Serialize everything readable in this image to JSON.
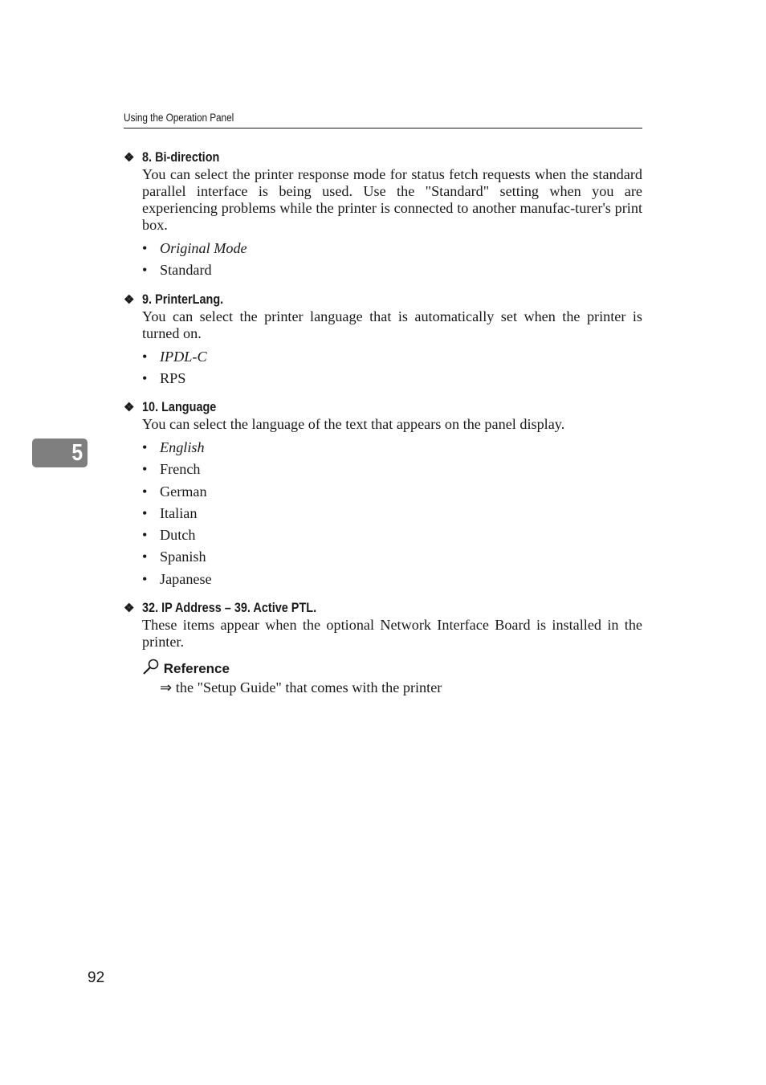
{
  "header": {
    "running_title": "Using the Operation Panel"
  },
  "chapter_tab": "5",
  "page_number": "92",
  "sections": [
    {
      "marker": "❖",
      "title": "8. Bi-direction",
      "text": "You can select the printer response mode for status fetch requests when the standard parallel interface is being used. Use the \"Standard\" setting when you are experiencing problems while the printer is connected to another manufac-turer's print box.",
      "options": [
        {
          "label": "Original Mode",
          "default": true
        },
        {
          "label": "Standard",
          "default": false
        }
      ]
    },
    {
      "marker": "❖",
      "title": "9. PrinterLang.",
      "text": "You can select the printer language that is automatically set when the printer is turned on.",
      "options": [
        {
          "label": "IPDL-C",
          "default": true
        },
        {
          "label": "RPS",
          "default": false
        }
      ]
    },
    {
      "marker": "❖",
      "title": "10. Language",
      "text": "You can select the language of the text that appears on the panel display.",
      "options": [
        {
          "label": "English",
          "default": true
        },
        {
          "label": "French",
          "default": false
        },
        {
          "label": "German",
          "default": false
        },
        {
          "label": "Italian",
          "default": false
        },
        {
          "label": "Dutch",
          "default": false
        },
        {
          "label": "Spanish",
          "default": false
        },
        {
          "label": "Japanese",
          "default": false
        }
      ]
    },
    {
      "marker": "❖",
      "title": "32. IP Address – 39. Active PTL.",
      "text": "These items appear when the optional Network Interface Board is installed in the printer.",
      "reference": {
        "icon": "magnifier-icon",
        "title": "Reference",
        "arrow": "⇒",
        "text": "the \"Setup Guide\" that comes with the printer"
      }
    }
  ],
  "bullet_glyph": "•"
}
